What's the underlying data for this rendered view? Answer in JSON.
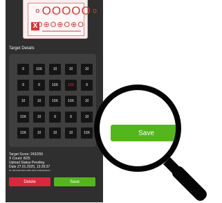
{
  "target_card": {
    "row1": "∘OOOOO∘",
    "row2": "O⊕O⊕O⊕O",
    "x_mark": "X"
  },
  "section_label": "Target Details",
  "grid": [
    [
      "9",
      "10X",
      "10",
      "10",
      "10"
    ],
    [
      "9",
      "9",
      "10X",
      "10X",
      "9"
    ],
    [
      "10",
      "10",
      "10X",
      "10X",
      "10"
    ],
    [
      "10X",
      "10",
      "9",
      "9",
      "10"
    ],
    [
      "10X",
      "10",
      "10",
      "10",
      "10X"
    ]
  ],
  "highlight_color": "#e3364a",
  "info": {
    "score": "Target Score: 243/250",
    "x_count": "X Count: 8/25",
    "upload_status": "Upload Status Pending",
    "date": "Date 27.01.2025, 13:29:37",
    "id": "ID: 39143d4f-f8d2-4d8b-a5b4-24f3bb6d9c0a"
  },
  "buttons": {
    "delete": "Delete",
    "save": "Save"
  },
  "magnifier": {
    "save": "Save"
  },
  "colors": {
    "save_green": "#55b51d",
    "delete_red": "#d8283d",
    "phone_bg": "#2f2f2f"
  }
}
